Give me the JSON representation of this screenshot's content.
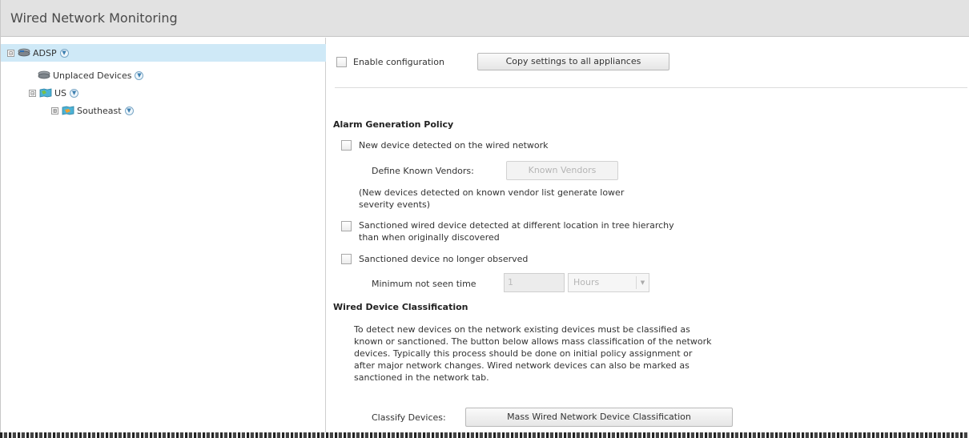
{
  "window": {
    "title": "Wired Network Monitoring"
  },
  "tree": {
    "nodes": [
      {
        "label": "ADSP",
        "expander": "⊟",
        "icon": "server-stack-icon",
        "selected": true
      },
      {
        "label": "Unplaced Devices",
        "expander": "",
        "icon": "server-stack-icon"
      },
      {
        "label": "US",
        "expander": "⊟",
        "icon": "region-map-icon"
      },
      {
        "label": "Southeast",
        "expander": "⊞",
        "icon": "region-map-icon"
      }
    ]
  },
  "content": {
    "enable_configuration_label": "Enable configuration",
    "copy_settings_button": "Copy settings to all appliances",
    "alarm_section_title": "Alarm Generation Policy",
    "new_device_label": "New device detected on the wired network",
    "define_known_vendors_label": "Define Known Vendors:",
    "known_vendors_button": "Known Vendors",
    "vendor_note_line1": "(New devices detected on known vendor list generate lower",
    "vendor_note_line2": "severity events)",
    "sanctioned_location_line1": "Sanctioned wired device detected at different location in tree hierarchy",
    "sanctioned_location_line2": "than when originally discovered",
    "sanctioned_not_observed_label": "Sanctioned device no longer observed",
    "minimum_not_seen_label": "Minimum not seen time",
    "minimum_not_seen_value": "1",
    "time_unit_value": "Hours",
    "classification_section_title": "Wired Device Classification",
    "classification_para": [
      "To detect new devices on the network existing devices must be classified as",
      "known or sanctioned. The button below allows mass classification of the network",
      "devices. Typically this process should be done on initial policy assignment or",
      "after major network changes. Wired network devices can also be marked as",
      "sanctioned in the network tab."
    ],
    "classify_devices_label": "Classify Devices:",
    "mass_classification_button": "Mass Wired Network Device Classification"
  }
}
